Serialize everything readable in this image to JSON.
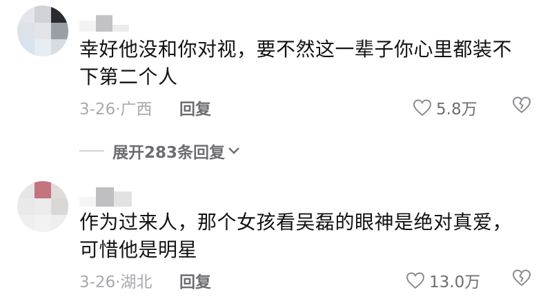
{
  "comments": [
    {
      "text": "幸好他没和你对视，要不然这一辈子你心里都装不下第二个人",
      "date_location": "3-26·广西",
      "reply_label": "回复",
      "likes": "5.8万",
      "avatar_colors": [
        "#e3e6ea",
        "#cfd2d6",
        "#2b2b2f",
        "#dde2e7",
        "#e1e4e8",
        "#9a9fa6",
        "#d7e3f0",
        "#e7ecf2",
        "#d6dce3"
      ]
    },
    {
      "text": "作为过来人，那个女孩看吴磊的眼神是绝对真爱，可惜他是明星",
      "date_location": "3-26·湖北",
      "reply_label": "回复",
      "likes": "13.0万",
      "avatar_colors": [
        "#e6e6e8",
        "#c4737f",
        "#dedcd8",
        "#e9e9ea",
        "#ececed",
        "#d9d8d6",
        "#efefef",
        "#f2f2f2",
        "#eeeeee"
      ]
    }
  ],
  "expand_replies": "展开283条回复",
  "icons": {
    "like": "heart-outline-icon",
    "dislike": "broken-heart-icon",
    "expand": "chevron-down-icon"
  },
  "colors": {
    "text": "#121212",
    "meta": "#a9a9ad",
    "action": "#6d6d72"
  }
}
